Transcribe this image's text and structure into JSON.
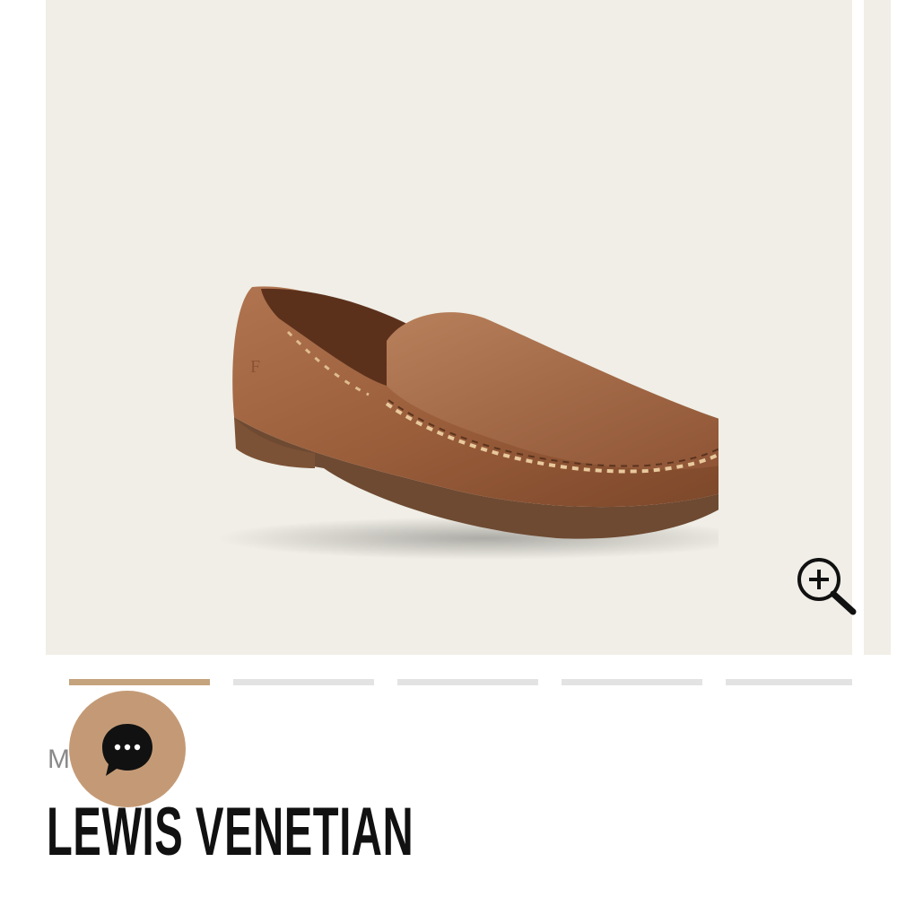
{
  "gallery": {
    "image_alt": "Brown leather moccasin loafer",
    "slide_count": 5,
    "active_slide": 1
  },
  "product": {
    "category_visible": "M",
    "title": "LEWIS VENETIAN"
  },
  "icons": {
    "zoom": "zoom-in-icon",
    "chat": "chat-bubble-icon"
  },
  "colors": {
    "gallery_background": "#f0eee6",
    "indicator_active": "#c4a37d",
    "indicator_inactive": "#e3e3e3",
    "chat_button": "#c49a76",
    "title_text": "#111111"
  }
}
